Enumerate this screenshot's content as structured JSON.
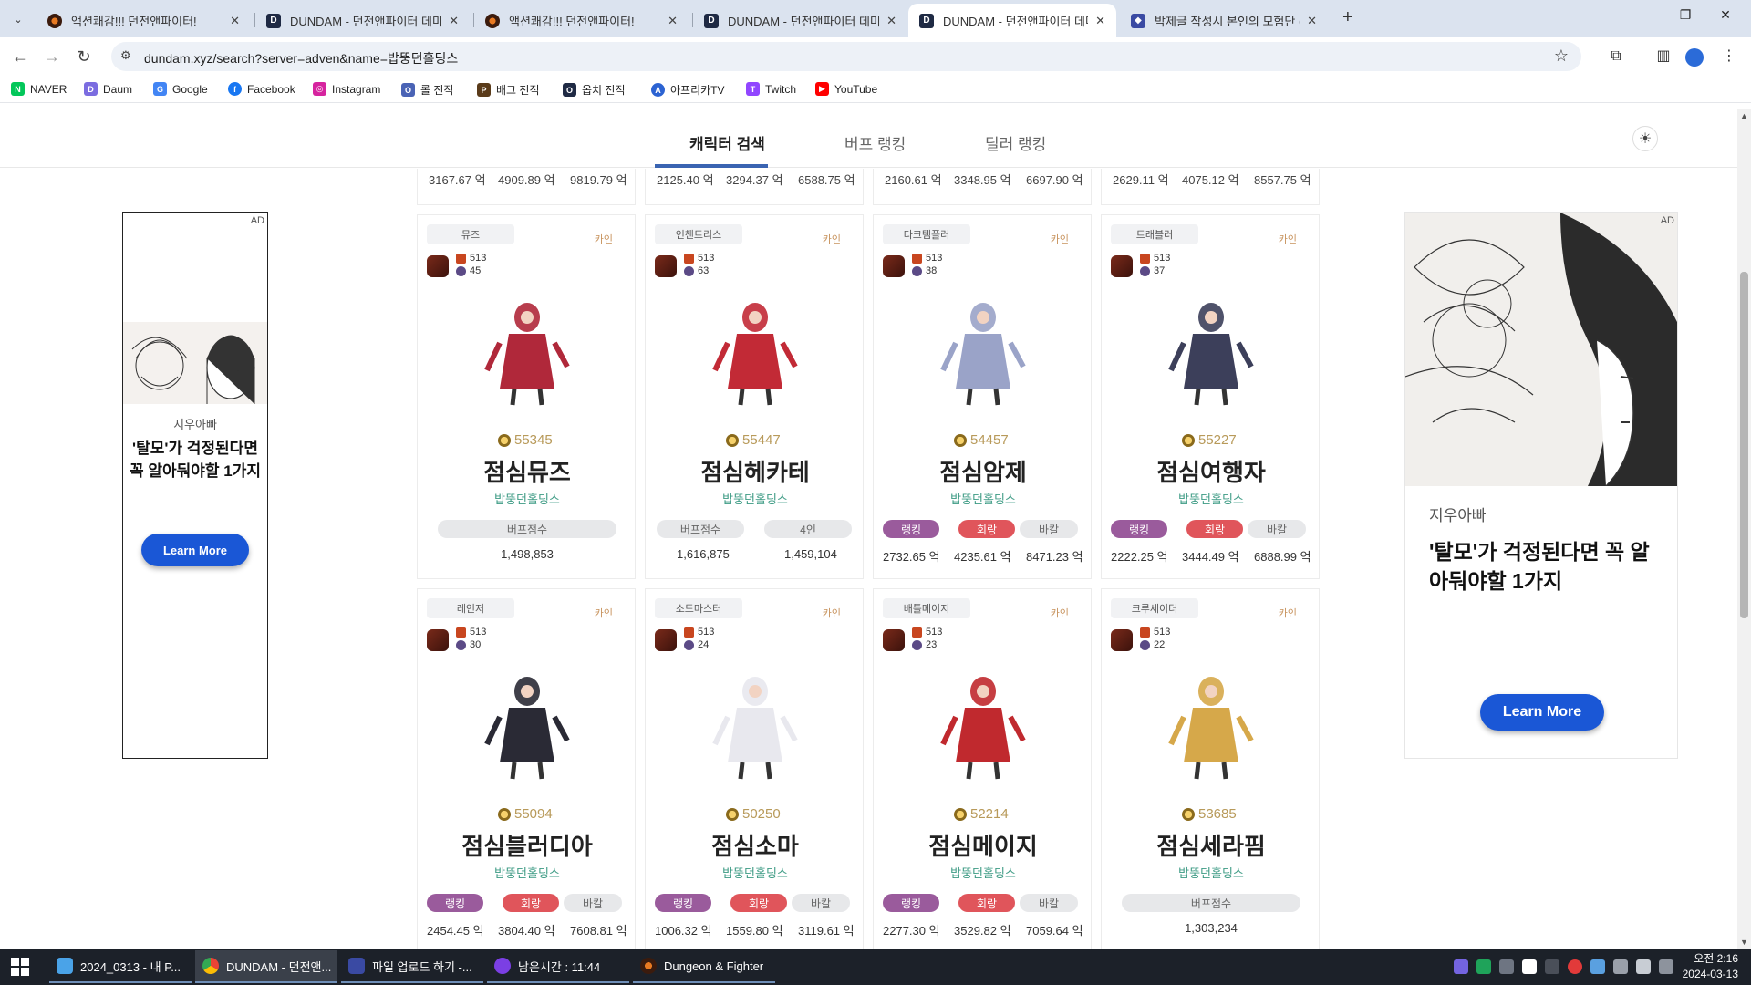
{
  "browser": {
    "tabs": [
      {
        "title": "액션쾌감!!! 던전앤파이터!",
        "icon": "game",
        "active": false
      },
      {
        "title": "DUNDAM - 던전앤파이터 데미",
        "icon": "dd",
        "active": false
      },
      {
        "title": "액션쾌감!!! 던전앤파이터!",
        "icon": "game",
        "active": false
      },
      {
        "title": "DUNDAM - 던전앤파이터 데미",
        "icon": "dd",
        "active": false
      },
      {
        "title": "DUNDAM - 던전앤파이터 데미",
        "icon": "dd",
        "active": true
      },
      {
        "title": "박제글 작성시 본인의 모험단 (",
        "icon": "mob",
        "active": false
      }
    ],
    "url": "dundam.xyz/search?server=adven&name=밥뚱던홀딩스",
    "bookmarks": [
      {
        "label": "NAVER",
        "color": "#03c75a",
        "glyph": "N"
      },
      {
        "label": "Daum",
        "color": "#7b6ce0",
        "glyph": "D"
      },
      {
        "label": "Google",
        "color": "#4285f4",
        "glyph": "G"
      },
      {
        "label": "Facebook",
        "color": "#1877f2",
        "glyph": "f"
      },
      {
        "label": "Instagram",
        "color": "#d6249f",
        "glyph": "◎"
      },
      {
        "label": "롤 전적",
        "color": "#4a63b5",
        "glyph": "OP"
      },
      {
        "label": "배그 전적",
        "color": "#5a3b1a",
        "glyph": "P"
      },
      {
        "label": "옵치 전적",
        "color": "#1f2a44",
        "glyph": "O"
      },
      {
        "label": "아프리카TV",
        "color": "#2c63d2",
        "glyph": "A"
      },
      {
        "label": "Twitch",
        "color": "#9146ff",
        "glyph": "T"
      },
      {
        "label": "YouTube",
        "color": "#ff0000",
        "glyph": "▶"
      }
    ]
  },
  "site": {
    "nav": {
      "search": "캐릭터 검색",
      "buff_rank": "버프 랭킹",
      "dealer_rank": "딜러 랭킹"
    },
    "prev_row": [
      [
        "3167.67 억",
        "4909.89 억",
        "9819.79 억"
      ],
      [
        "2125.40 억",
        "3294.37 억",
        "6588.75 억"
      ],
      [
        "2160.61 억",
        "3348.95 억",
        "6697.90 억"
      ],
      [
        "2629.11 억",
        "4075.12 억",
        "8557.75 억"
      ]
    ],
    "labels": {
      "rank": "랭킹",
      "hoe": "회랑",
      "bar": "바칼",
      "buff": "버프점수",
      "four": "4인"
    },
    "cards": [
      {
        "job": "뮤즈",
        "server": "카인",
        "lv1": "513",
        "lv2": "45",
        "fame": "55345",
        "name": "점심뮤즈",
        "guild": "밥뚱던홀딩스",
        "kind": "buff",
        "values": [
          "1,498,853"
        ],
        "color": "#b0283a"
      },
      {
        "job": "인챈트리스",
        "server": "카인",
        "lv1": "513",
        "lv2": "63",
        "fame": "55447",
        "name": "점심헤카테",
        "guild": "밥뚱던홀딩스",
        "kind": "buff4",
        "values": [
          "1,616,875",
          "1,459,104"
        ],
        "color": "#c22a36"
      },
      {
        "job": "다크템플러",
        "server": "카인",
        "lv1": "513",
        "lv2": "38",
        "fame": "54457",
        "name": "점심암제",
        "guild": "밥뚱던홀딩스",
        "kind": "dealer",
        "values": [
          "2732.65 억",
          "4235.61 억",
          "8471.23 억"
        ],
        "color": "#9aa3c8"
      },
      {
        "job": "트래블러",
        "server": "카인",
        "lv1": "513",
        "lv2": "37",
        "fame": "55227",
        "name": "점심여행자",
        "guild": "밥뚱던홀딩스",
        "kind": "dealer",
        "values": [
          "2222.25 억",
          "3444.49 억",
          "6888.99 억"
        ],
        "color": "#3c3f5a"
      },
      {
        "job": "레인저",
        "server": "카인",
        "lv1": "513",
        "lv2": "30",
        "fame": "55094",
        "name": "점심블러디아",
        "guild": "밥뚱던홀딩스",
        "kind": "dealer",
        "values": [
          "2454.45 억",
          "3804.40 억",
          "7608.81 억"
        ],
        "color": "#2a2a35"
      },
      {
        "job": "소드마스터",
        "server": "카인",
        "lv1": "513",
        "lv2": "24",
        "fame": "50250",
        "name": "점심소마",
        "guild": "밥뚱던홀딩스",
        "kind": "dealer",
        "values": [
          "1006.32 억",
          "1559.80 억",
          "3119.61 억"
        ],
        "color": "#e8e8ee"
      },
      {
        "job": "배틀메이지",
        "server": "카인",
        "lv1": "513",
        "lv2": "23",
        "fame": "52214",
        "name": "점심메이지",
        "guild": "밥뚱던홀딩스",
        "kind": "dealer",
        "values": [
          "2277.30 억",
          "3529.82 억",
          "7059.64 억"
        ],
        "color": "#c0292e"
      },
      {
        "job": "크루세이더",
        "server": "카인",
        "lv1": "513",
        "lv2": "22",
        "fame": "53685",
        "name": "점심세라핌",
        "guild": "밥뚱던홀딩스",
        "kind": "buff",
        "values": [
          "1,303,234"
        ],
        "color": "#d6a84a"
      }
    ]
  },
  "ads": {
    "label": "AD",
    "brand": "지우아빠",
    "headline": "'탈모'가 걱정된다면 꼭 알아둬야할 1가지",
    "cta": "Learn More"
  },
  "scroll": {
    "fraction": 0.32
  },
  "taskbar": {
    "items": [
      {
        "label": "2024_0313 - 내 P...",
        "color": "#4aa3e8"
      },
      {
        "label": "DUNDAM - 던전앤...",
        "color": "#e8a033",
        "active": true
      },
      {
        "label": "파일 업로드 하기 -...",
        "color": "#3a4aa3"
      },
      {
        "label": "남은시간 : 11:44",
        "color": "#7b3fe4"
      },
      {
        "label": "Dungeon & Fighter",
        "color": "#a0461f"
      }
    ],
    "time": "오전 2:16",
    "date": "2024-03-13"
  }
}
